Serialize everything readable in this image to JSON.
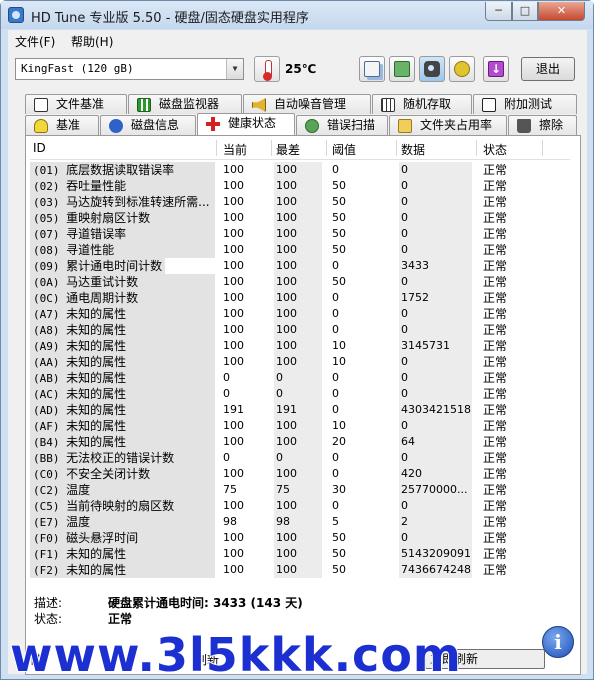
{
  "window": {
    "title": "HD Tune 专业版 5.50 - 硬盘/固态硬盘实用程序",
    "min_label": "─",
    "max_label": "□",
    "close_label": "✕"
  },
  "menu": [
    "文件(F)",
    "帮助(H)"
  ],
  "toolbar": {
    "drive": "KingFast (120 gB)",
    "temperature": "25℃",
    "exit_label": "退出",
    "down_glyph": "↓"
  },
  "tabs_top": [
    "文件基准",
    "磁盘监视器",
    "自动噪音管理",
    "随机存取",
    "附加测试"
  ],
  "tabs_bottom": [
    "基准",
    "磁盘信息",
    "健康状态",
    "错误扫描",
    "文件夹占用率",
    "擦除"
  ],
  "active_tab": "健康状态",
  "columns": [
    "ID",
    "当前",
    "最差",
    "阈值",
    "数据",
    "状态"
  ],
  "rows": [
    {
      "id": "(01)",
      "name": "底层数据读取错误率",
      "cur": "100",
      "worst": "100",
      "thr": "0",
      "data": "0",
      "status": "正常"
    },
    {
      "id": "(02)",
      "name": "吞吐量性能",
      "cur": "100",
      "worst": "100",
      "thr": "50",
      "data": "0",
      "status": "正常"
    },
    {
      "id": "(03)",
      "name": "马达旋转到标准转速所需...",
      "cur": "100",
      "worst": "100",
      "thr": "50",
      "data": "0",
      "status": "正常"
    },
    {
      "id": "(05)",
      "name": "重映射扇区计数",
      "cur": "100",
      "worst": "100",
      "thr": "50",
      "data": "0",
      "status": "正常"
    },
    {
      "id": "(07)",
      "name": "寻道错误率",
      "cur": "100",
      "worst": "100",
      "thr": "50",
      "data": "0",
      "status": "正常"
    },
    {
      "id": "(08)",
      "name": "寻道性能",
      "cur": "100",
      "worst": "100",
      "thr": "50",
      "data": "0",
      "status": "正常"
    },
    {
      "id": "(09)",
      "name": "累计通电时间计数",
      "cur": "100",
      "worst": "100",
      "thr": "0",
      "data": "3433",
      "status": "正常"
    },
    {
      "id": "(0A)",
      "name": "马达重试计数",
      "cur": "100",
      "worst": "100",
      "thr": "50",
      "data": "0",
      "status": "正常"
    },
    {
      "id": "(0C)",
      "name": "通电周期计数",
      "cur": "100",
      "worst": "100",
      "thr": "0",
      "data": "1752",
      "status": "正常"
    },
    {
      "id": "(A7)",
      "name": "未知的属性",
      "cur": "100",
      "worst": "100",
      "thr": "0",
      "data": "0",
      "status": "正常"
    },
    {
      "id": "(A8)",
      "name": "未知的属性",
      "cur": "100",
      "worst": "100",
      "thr": "0",
      "data": "0",
      "status": "正常"
    },
    {
      "id": "(A9)",
      "name": "未知的属性",
      "cur": "100",
      "worst": "100",
      "thr": "10",
      "data": "3145731",
      "status": "正常"
    },
    {
      "id": "(AA)",
      "name": "未知的属性",
      "cur": "100",
      "worst": "100",
      "thr": "10",
      "data": "0",
      "status": "正常"
    },
    {
      "id": "(AB)",
      "name": "未知的属性",
      "cur": "0",
      "worst": "0",
      "thr": "0",
      "data": "0",
      "status": "正常"
    },
    {
      "id": "(AC)",
      "name": "未知的属性",
      "cur": "0",
      "worst": "0",
      "thr": "0",
      "data": "0",
      "status": "正常"
    },
    {
      "id": "(AD)",
      "name": "未知的属性",
      "cur": "191",
      "worst": "191",
      "thr": "0",
      "data": "4303421518",
      "status": "正常"
    },
    {
      "id": "(AF)",
      "name": "未知的属性",
      "cur": "100",
      "worst": "100",
      "thr": "10",
      "data": "0",
      "status": "正常"
    },
    {
      "id": "(B4)",
      "name": "未知的属性",
      "cur": "100",
      "worst": "100",
      "thr": "20",
      "data": "64",
      "status": "正常"
    },
    {
      "id": "(BB)",
      "name": "无法校正的错误计数",
      "cur": "0",
      "worst": "0",
      "thr": "0",
      "data": "0",
      "status": "正常"
    },
    {
      "id": "(C0)",
      "name": "不安全关闭计数",
      "cur": "100",
      "worst": "100",
      "thr": "0",
      "data": "420",
      "status": "正常"
    },
    {
      "id": "(C2)",
      "name": "温度",
      "cur": "75",
      "worst": "75",
      "thr": "30",
      "data": "25770000...",
      "status": "正常"
    },
    {
      "id": "(C5)",
      "name": "当前待映射的扇区数",
      "cur": "100",
      "worst": "100",
      "thr": "0",
      "data": "0",
      "status": "正常"
    },
    {
      "id": "(E7)",
      "name": "温度",
      "cur": "98",
      "worst": "98",
      "thr": "5",
      "data": "2",
      "status": "正常"
    },
    {
      "id": "(F0)",
      "name": "磁头悬浮时间",
      "cur": "100",
      "worst": "100",
      "thr": "50",
      "data": "0",
      "status": "正常"
    },
    {
      "id": "(F1)",
      "name": "未知的属性",
      "cur": "100",
      "worst": "100",
      "thr": "50",
      "data": "5143209091",
      "status": "正常"
    },
    {
      "id": "(F2)",
      "name": "未知的属性",
      "cur": "100",
      "worst": "100",
      "thr": "50",
      "data": "7436674248",
      "status": "正常"
    }
  ],
  "description": {
    "desc_label": "描述:",
    "desc_value": "硬盘累计通电时间: 3433 (143 天)",
    "status_label": "状态:",
    "status_value": "正常"
  },
  "bottom": {
    "left": "健",
    "mid": "刷新",
    "right": "立即刷新"
  },
  "watermark": "www.3l5kkk.com",
  "colors": {
    "accent": "#1c2fd0",
    "title_bg": "#cfe0f2"
  }
}
